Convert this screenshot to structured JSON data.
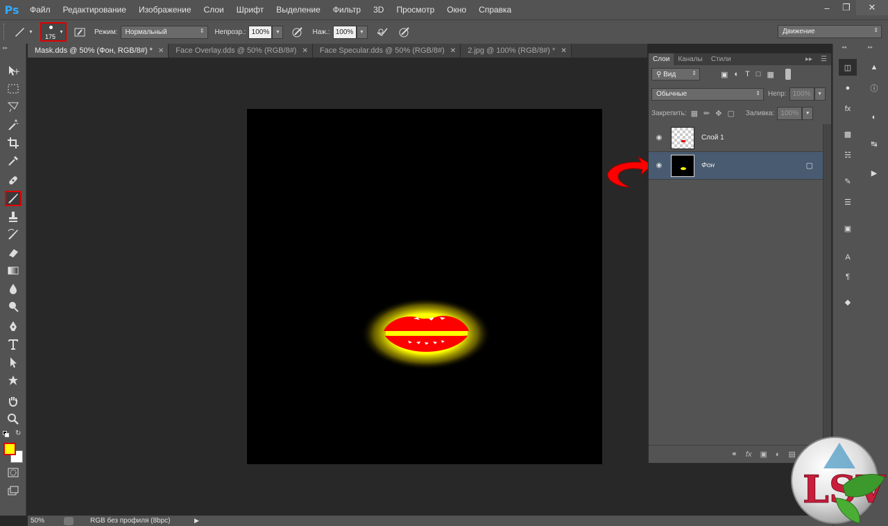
{
  "app": {
    "logo": "Ps"
  },
  "menu": [
    "Файл",
    "Редактирование",
    "Изображение",
    "Слои",
    "Шрифт",
    "Выделение",
    "Фильтр",
    "3D",
    "Просмотр",
    "Окно",
    "Справка"
  ],
  "options": {
    "brush_size": "175",
    "mode_label": "Режим:",
    "mode_value": "Нормальный",
    "opacity_label": "Непрозр.:",
    "opacity_value": "100%",
    "pressure_label": "Наж.:",
    "pressure_value": "100%",
    "workspace": "Движение"
  },
  "tabs": [
    {
      "label": "Mask.dds @ 50% (Фон, RGB/8#) *",
      "active": true
    },
    {
      "label": "Face Overlay.dds @ 50% (RGB/8#)",
      "active": false
    },
    {
      "label": "Face Specular.dds @ 50% (RGB/8#)",
      "active": false
    },
    {
      "label": "2.jpg @ 100% (RGB/8#) *",
      "active": false
    }
  ],
  "status": {
    "zoom": "50%",
    "profile": "RGB без профиля (8bpc)"
  },
  "colors": {
    "foreground": "#ffff00",
    "background": "#ffffff",
    "highlight": "#e00000",
    "selected_layer": "#485b70"
  },
  "layers_panel": {
    "tabs": [
      "Слои",
      "Каналы",
      "Стили"
    ],
    "filter": "Вид",
    "blend": "Обычные",
    "opacity_label": "Непр:",
    "opacity_value": "100%",
    "lock_label": "Закрепить:",
    "fill_label": "Заливка:",
    "fill_value": "100%",
    "layers": [
      {
        "name": "Слой 1",
        "selected": false
      },
      {
        "name": "Фон",
        "selected": true,
        "locked": true
      }
    ]
  },
  "watermark": "LSV"
}
